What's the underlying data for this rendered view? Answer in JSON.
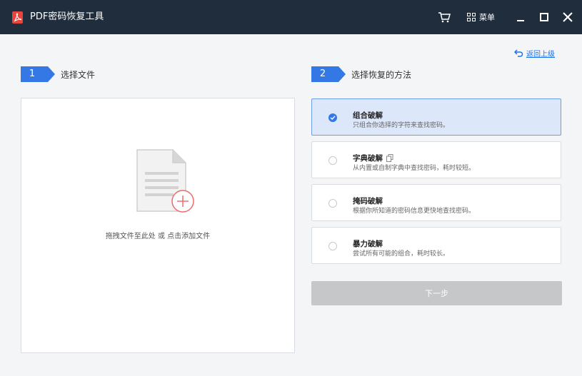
{
  "window": {
    "title": "PDF密码恢复工具",
    "menu_label": "菜单"
  },
  "nav": {
    "back_label": "返回上级"
  },
  "steps": [
    {
      "number": "1",
      "label": "选择文件"
    },
    {
      "number": "2",
      "label": "选择恢复的方法"
    }
  ],
  "dropzone": {
    "text": "拖拽文件至此处 或 点击添加文件"
  },
  "methods": [
    {
      "title": "组合破解",
      "desc": "只组合你选择的字符来查找密码。",
      "selected": true
    },
    {
      "title": "字典破解",
      "desc": "从内置或自制字典中查找密码，耗时较短。",
      "selected": false
    },
    {
      "title": "掩码破解",
      "desc": "根据你所知道的密码信息更快地查找密码。",
      "selected": false
    },
    {
      "title": "暴力破解",
      "desc": "尝试所有可能的组合，耗时较长。",
      "selected": false
    }
  ],
  "actions": {
    "next_label": "下一步"
  },
  "colors": {
    "titlebar": "#1f2d3d",
    "accent": "#3478e6",
    "selected_bg": "#dce7fa",
    "logo": "#e8453c",
    "disabled_button": "#c6c7c9"
  }
}
